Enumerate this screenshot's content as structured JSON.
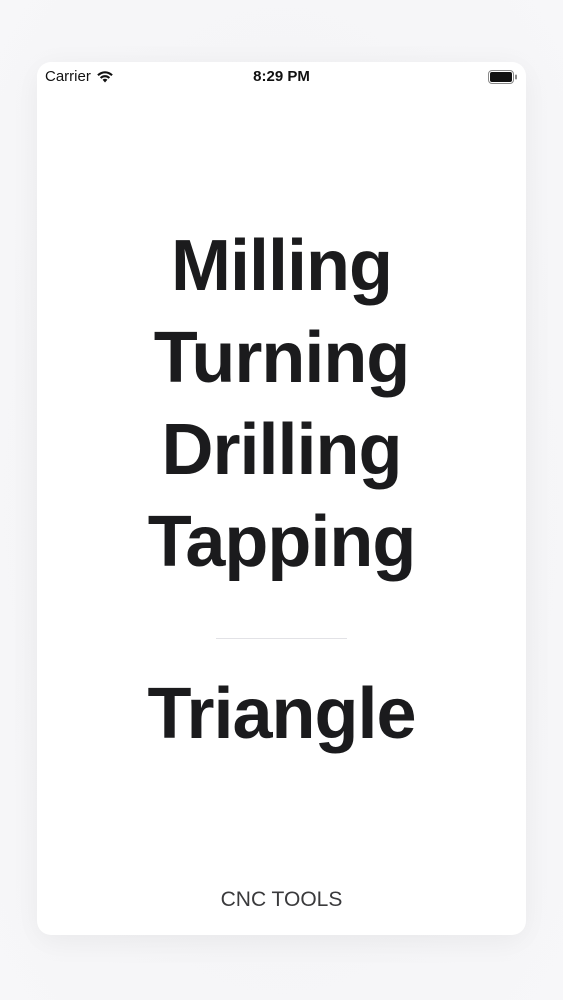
{
  "status_bar": {
    "carrier": "Carrier",
    "time": "8:29 PM"
  },
  "menu": {
    "items": [
      "Milling",
      "Turning",
      "Drilling",
      "Tapping"
    ],
    "secondary": "Triangle"
  },
  "footer": {
    "label": "CNC TOOLS"
  },
  "colors": {
    "text": "#1b1b1d",
    "background": "#ffffff",
    "divider": "#e2e2e6"
  },
  "icons": [
    "wifi-icon",
    "battery-icon"
  ]
}
